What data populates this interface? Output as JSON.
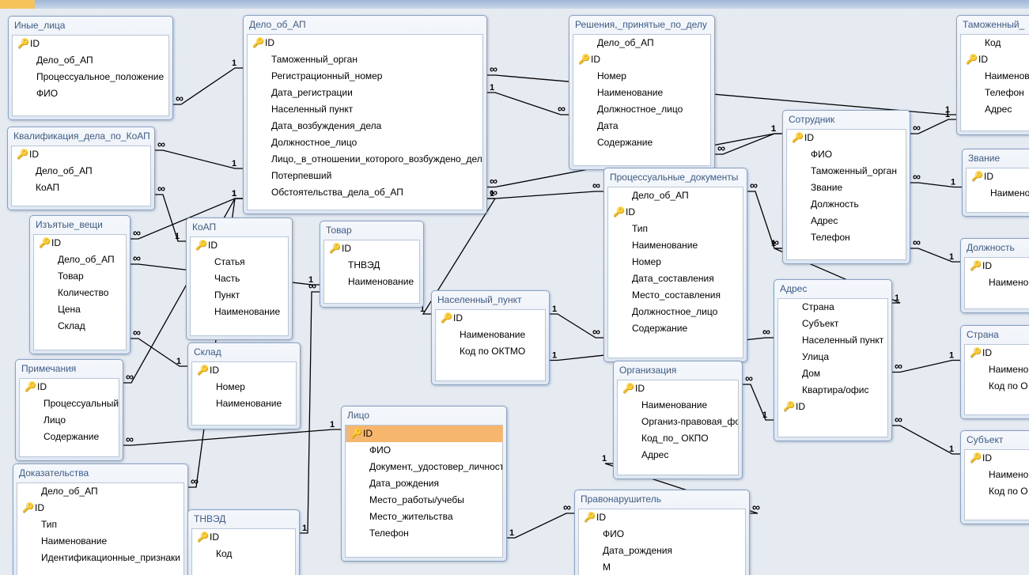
{
  "tables": {
    "inye_litsa": {
      "title": "Иные_лица",
      "fields": [
        "ID",
        "Дело_об_АП",
        "Процессуальное_положение",
        "ФИО"
      ]
    },
    "delo": {
      "title": "Дело_об_АП",
      "fields": [
        "ID",
        "Таможенный_орган",
        "Регистрационный_номер",
        "Дата_регистрации",
        "Населенный пункт",
        "Дата_возбуждения_дела",
        "Должностное_лицо",
        "Лицо,_в_отношении_которого_возбуждено_дело",
        "Потерпевший",
        "Обстоятельства_дела_об_АП"
      ]
    },
    "resheniya": {
      "title": "Решения,_принятые_по_делу",
      "fields": [
        "Дело_об_АП",
        "ID",
        "Номер",
        "Наименование",
        "Должностное_лицо",
        "Дата",
        "Содержание"
      ]
    },
    "tamozh": {
      "title": "Таможенный_",
      "fields": [
        "Код",
        "ID",
        "Наименов",
        "Телефон",
        "Адрес"
      ]
    },
    "kvalif": {
      "title": "Квалификация_дела_по_КоАП",
      "fields": [
        "ID",
        "Дело_об_АП",
        "КоАП"
      ]
    },
    "sotrudnik": {
      "title": "Сотрудник",
      "fields": [
        "ID",
        "ФИО",
        "Таможенный_орган",
        "Звание",
        "Должность",
        "Адрес",
        "Телефон"
      ]
    },
    "zvanie": {
      "title": "Звание",
      "fields": [
        "ID",
        "Наимено"
      ]
    },
    "izyatye": {
      "title": "Изъятые_вещи",
      "fields": [
        "ID",
        "Дело_об_АП",
        "Товар",
        "Количество",
        "Цена",
        "Склад"
      ]
    },
    "koap": {
      "title": "КоАП",
      "fields": [
        "ID",
        "Статья",
        "Часть",
        "Пункт",
        "Наименование"
      ]
    },
    "tovar": {
      "title": "Товар",
      "fields": [
        "ID",
        "ТНВЭД",
        "Наименование"
      ]
    },
    "procdoc": {
      "title": "Процессуальные_документы",
      "fields": [
        "Дело_об_АП",
        "ID",
        "Тип",
        "Наименование",
        "Номер",
        "Дата_составления",
        "Место_составления",
        "Должностное_лицо",
        "Содержание"
      ]
    },
    "dolzhnost": {
      "title": "Должность",
      "fields": [
        "ID",
        "Наимено"
      ]
    },
    "naspunkt": {
      "title": "Населенный_пункт",
      "fields": [
        "ID",
        "Наименование",
        "Код по ОКТМО"
      ]
    },
    "adres": {
      "title": "Адрес",
      "fields": [
        "Страна",
        "Субъект",
        "Населенный пункт",
        "Улица",
        "Дом",
        "Квартира/офис",
        "ID"
      ]
    },
    "strana": {
      "title": "Страна",
      "fields": [
        "ID",
        "Наимено",
        "Код по О"
      ]
    },
    "primech": {
      "title": "Примечания",
      "fields": [
        "ID",
        "Процессуальный",
        "Лицо",
        "Содержание"
      ]
    },
    "sklad": {
      "title": "Склад",
      "fields": [
        "ID",
        "Номер",
        "Наименование"
      ]
    },
    "organiz": {
      "title": "Организация",
      "fields": [
        "ID",
        "Наименование",
        "Организ-правовая_фо",
        "Код_по_ ОКПО",
        "Адрес"
      ]
    },
    "litso": {
      "title": "Лицо",
      "fields": [
        "ID",
        "ФИО",
        "Документ,_удостовер_личность",
        "Дата_рождения",
        "Место_работы/учебы",
        "Место_жительства",
        "Телефон"
      ]
    },
    "subekt": {
      "title": "Субъект",
      "fields": [
        "ID",
        "Наимено",
        "Код по О"
      ]
    },
    "dokaz": {
      "title": "Доказательства",
      "fields": [
        "Дело_об_АП",
        "ID",
        "Тип",
        "Наименование",
        "Идентификационные_признаки"
      ]
    },
    "tnved": {
      "title": "ТНВЭД",
      "fields": [
        "ID",
        "Код"
      ]
    },
    "pravonar": {
      "title": "Правонарушитель",
      "fields": [
        "ID",
        "ФИО",
        "Дата_рождения",
        "М"
      ]
    }
  },
  "relationships": [
    {
      "from": "inye_litsa",
      "to": "delo",
      "from_card": "∞",
      "to_card": "1"
    },
    {
      "from": "kvalif",
      "to": "delo",
      "from_card": "∞",
      "to_card": "1"
    },
    {
      "from": "izyatye",
      "to": "delo",
      "from_card": "∞",
      "to_card": "1"
    },
    {
      "from": "primech",
      "to": "delo",
      "from_card": "∞",
      "to_card": "1"
    },
    {
      "from": "dokaz",
      "to": "delo",
      "from_card": "∞",
      "to_card": "1"
    },
    {
      "from": "kvalif",
      "to": "koap",
      "from_card": "∞",
      "to_card": "1"
    },
    {
      "from": "resheniya",
      "to": "delo",
      "from_card": "∞",
      "to_card": "1"
    },
    {
      "from": "procdoc",
      "to": "delo",
      "from_card": "∞",
      "to_card": "1"
    },
    {
      "from": "tamozh",
      "to": "delo",
      "from_card": "1",
      "to_card": "∞"
    },
    {
      "from": "sotrudnik",
      "to": "delo",
      "from_card": "1",
      "to_card": "∞"
    },
    {
      "from": "sotrudnik",
      "to": "resheniya",
      "from_card": "1",
      "to_card": "∞"
    },
    {
      "from": "sotrudnik",
      "to": "procdoc",
      "from_card": "1",
      "to_card": "∞"
    },
    {
      "from": "zvanie",
      "to": "sotrudnik",
      "from_card": "1",
      "to_card": "∞"
    },
    {
      "from": "dolzhnost",
      "to": "sotrudnik",
      "from_card": "1",
      "to_card": "∞"
    },
    {
      "from": "tamozh",
      "to": "sotrudnik",
      "from_card": "1",
      "to_card": "∞"
    },
    {
      "from": "tovar",
      "to": "izyatye",
      "from_card": "1",
      "to_card": "∞"
    },
    {
      "from": "tnved",
      "to": "tovar",
      "from_card": "1",
      "to_card": "∞"
    },
    {
      "from": "sklad",
      "to": "izyatye",
      "from_card": "1",
      "to_card": "∞"
    },
    {
      "from": "naspunkt",
      "to": "delo",
      "from_card": "1",
      "to_card": "∞"
    },
    {
      "from": "naspunkt",
      "to": "procdoc",
      "from_card": "1",
      "to_card": "∞"
    },
    {
      "from": "naspunkt",
      "to": "adres",
      "from_card": "1",
      "to_card": "∞"
    },
    {
      "from": "strana",
      "to": "adres",
      "from_card": "1",
      "to_card": "∞"
    },
    {
      "from": "subekt",
      "to": "adres",
      "from_card": "1",
      "to_card": "∞"
    },
    {
      "from": "adres",
      "to": "sotrudnik",
      "from_card": "1",
      "to_card": "∞"
    },
    {
      "from": "adres",
      "to": "organiz",
      "from_card": "1",
      "to_card": "∞"
    },
    {
      "from": "litso",
      "to": "primech",
      "from_card": "1",
      "to_card": "∞"
    },
    {
      "from": "organiz",
      "to": "pravonar",
      "from_card": "1",
      "to_card": "∞"
    },
    {
      "from": "litso",
      "to": "pravonar",
      "from_card": "1",
      "to_card": "∞"
    }
  ]
}
